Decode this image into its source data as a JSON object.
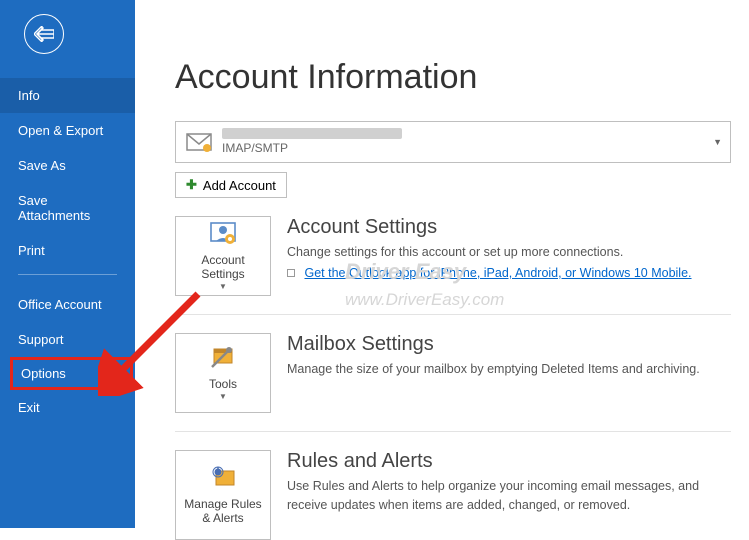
{
  "sidebar": {
    "items": [
      {
        "label": "Info"
      },
      {
        "label": "Open & Export"
      },
      {
        "label": "Save As"
      },
      {
        "label": "Save Attachments"
      },
      {
        "label": "Print"
      },
      {
        "label": "Office Account"
      },
      {
        "label": "Support"
      },
      {
        "label": "Options"
      },
      {
        "label": "Exit"
      }
    ]
  },
  "main": {
    "title": "Account Information",
    "account_selector": {
      "protocol": "IMAP/SMTP"
    },
    "add_account_label": "Add Account"
  },
  "sections": {
    "account_settings": {
      "card_label": "Account Settings",
      "title": "Account Settings",
      "desc": "Change settings for this account or set up more connections.",
      "mobile_link": "Get the Outlook app for iPhone, iPad, Android, or Windows 10 Mobile."
    },
    "mailbox_settings": {
      "card_label": "Tools",
      "title": "Mailbox Settings",
      "desc": "Manage the size of your mailbox by emptying Deleted Items and archiving."
    },
    "rules_alerts": {
      "card_label": "Manage Rules & Alerts",
      "title": "Rules and Alerts",
      "desc": "Use Rules and Alerts to help organize your incoming email messages, and receive updates when items are added, changed, or removed."
    }
  },
  "watermark": {
    "line1": "Driver Easy",
    "line2": "www.DriverEasy.com"
  }
}
